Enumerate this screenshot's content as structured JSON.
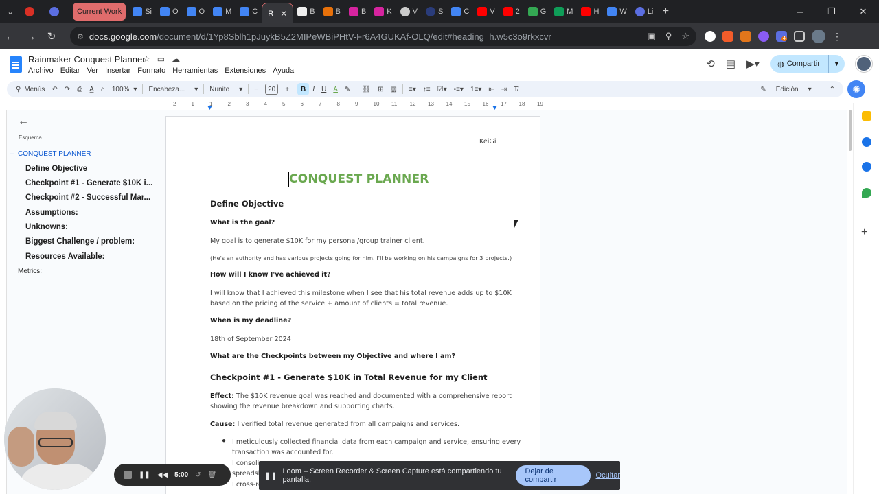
{
  "browser": {
    "tabs": [
      {
        "label": "Current Work",
        "type": "group"
      },
      {
        "label": "Si"
      },
      {
        "label": "O"
      },
      {
        "label": "O"
      },
      {
        "label": "M"
      },
      {
        "label": "C"
      },
      {
        "label": "R",
        "active": true
      },
      {
        "label": "B"
      },
      {
        "label": "B"
      },
      {
        "label": "B"
      },
      {
        "label": "K"
      },
      {
        "label": "V"
      },
      {
        "label": "S"
      },
      {
        "label": "C"
      },
      {
        "label": "V"
      },
      {
        "label": "2"
      },
      {
        "label": "G"
      },
      {
        "label": "M"
      },
      {
        "label": "H"
      },
      {
        "label": "W"
      },
      {
        "label": "Li"
      }
    ],
    "url_host": "docs.google.com",
    "url_path": "/document/d/1Yp8Sblh1pJuykB5Z2MIPeWBiPHtV-Fr6A4GUKAf-OLQ/edit#heading=h.w5c3o9rkxcvr",
    "extension_badge": "4"
  },
  "docs": {
    "title": "Rainmaker Conquest Planner",
    "menu": [
      "Archivo",
      "Editar",
      "Ver",
      "Insertar",
      "Formato",
      "Herramientas",
      "Extensiones",
      "Ayuda"
    ],
    "share_label": "Compartir",
    "toolbar": {
      "search_label": "Menús",
      "zoom": "100%",
      "style": "Encabeza...",
      "font": "Nunito",
      "font_size": "20",
      "mode": "Edición"
    },
    "ruler_numbers": [
      "2",
      "1",
      "1",
      "2",
      "3",
      "4",
      "5",
      "6",
      "7",
      "8",
      "9",
      "10",
      "11",
      "12",
      "13",
      "14",
      "15",
      "16",
      "17",
      "18",
      "19"
    ]
  },
  "outline": {
    "heading": "Esquema",
    "items": [
      {
        "label": "CONQUEST PLANNER",
        "level": 1,
        "active": true
      },
      {
        "label": "Define Objective",
        "level": 2
      },
      {
        "label": "Checkpoint #1 - Generate $10K i...",
        "level": 2
      },
      {
        "label": "Checkpoint #2 - Successful Mar...",
        "level": 2
      },
      {
        "label": "Assumptions:",
        "level": 2
      },
      {
        "label": "Unknowns:",
        "level": 2
      },
      {
        "label": "Biggest Challenge / problem:",
        "level": 2
      },
      {
        "label": "Resources Available:",
        "level": 2
      },
      {
        "label": "Metrics:",
        "level": 1
      }
    ]
  },
  "document": {
    "header_right": "KeiGi",
    "title": "CONQUEST PLANNER",
    "section1_heading": "Define Objective",
    "q1": "What is the goal?",
    "a1": "My goal is to generate $10K for my personal/group trainer client.",
    "a1_note": "(He's an authority and has various projects going for him. I'll be working on his campaigns for 3 projects.)",
    "q2": "How will I know I've achieved it?",
    "a2_line1": "I will know that I achieved this milestone when I see that his total revenue adds up to $10K",
    "a2_line2": "based on the pricing of the service + amount of clients = total revenue.",
    "q3": "When is my deadline?",
    "a3": "18th of September 2024",
    "q4": "What are the Checkpoints between my Objective and where I am?",
    "checkpoint1_heading": "Checkpoint #1 - Generate $10K in Total Revenue for my Client",
    "effect_label": "Effect:",
    "effect_line1": " The $10K revenue goal was reached and documented with a comprehensive report",
    "effect_line2": "showing the revenue breakdown and supporting charts.",
    "cause_label": "Cause:",
    "cause_text": " I verified total revenue generated from all campaigns and services.",
    "bullet1_line1": "I meticulously collected financial data from each campaign and service, ensuring every",
    "bullet1_line2": "transaction was accounted for.",
    "bullet2_partial": "I consoli",
    "bullet2_partial2": "spreadsh",
    "bullet3_partial": "I cross-re"
  },
  "loom": {
    "timer": "5:00",
    "banner_text": "Loom – Screen Recorder & Screen Capture está compartiendo tu pantalla.",
    "stop_sharing": "Dejar de compartir",
    "hide": "Ocultar"
  },
  "colors": {
    "title_green": "#6aa84f",
    "outline_active": "#0b57d0",
    "share_bg": "#c2e7ff",
    "tab_group": "#e06c6c"
  }
}
